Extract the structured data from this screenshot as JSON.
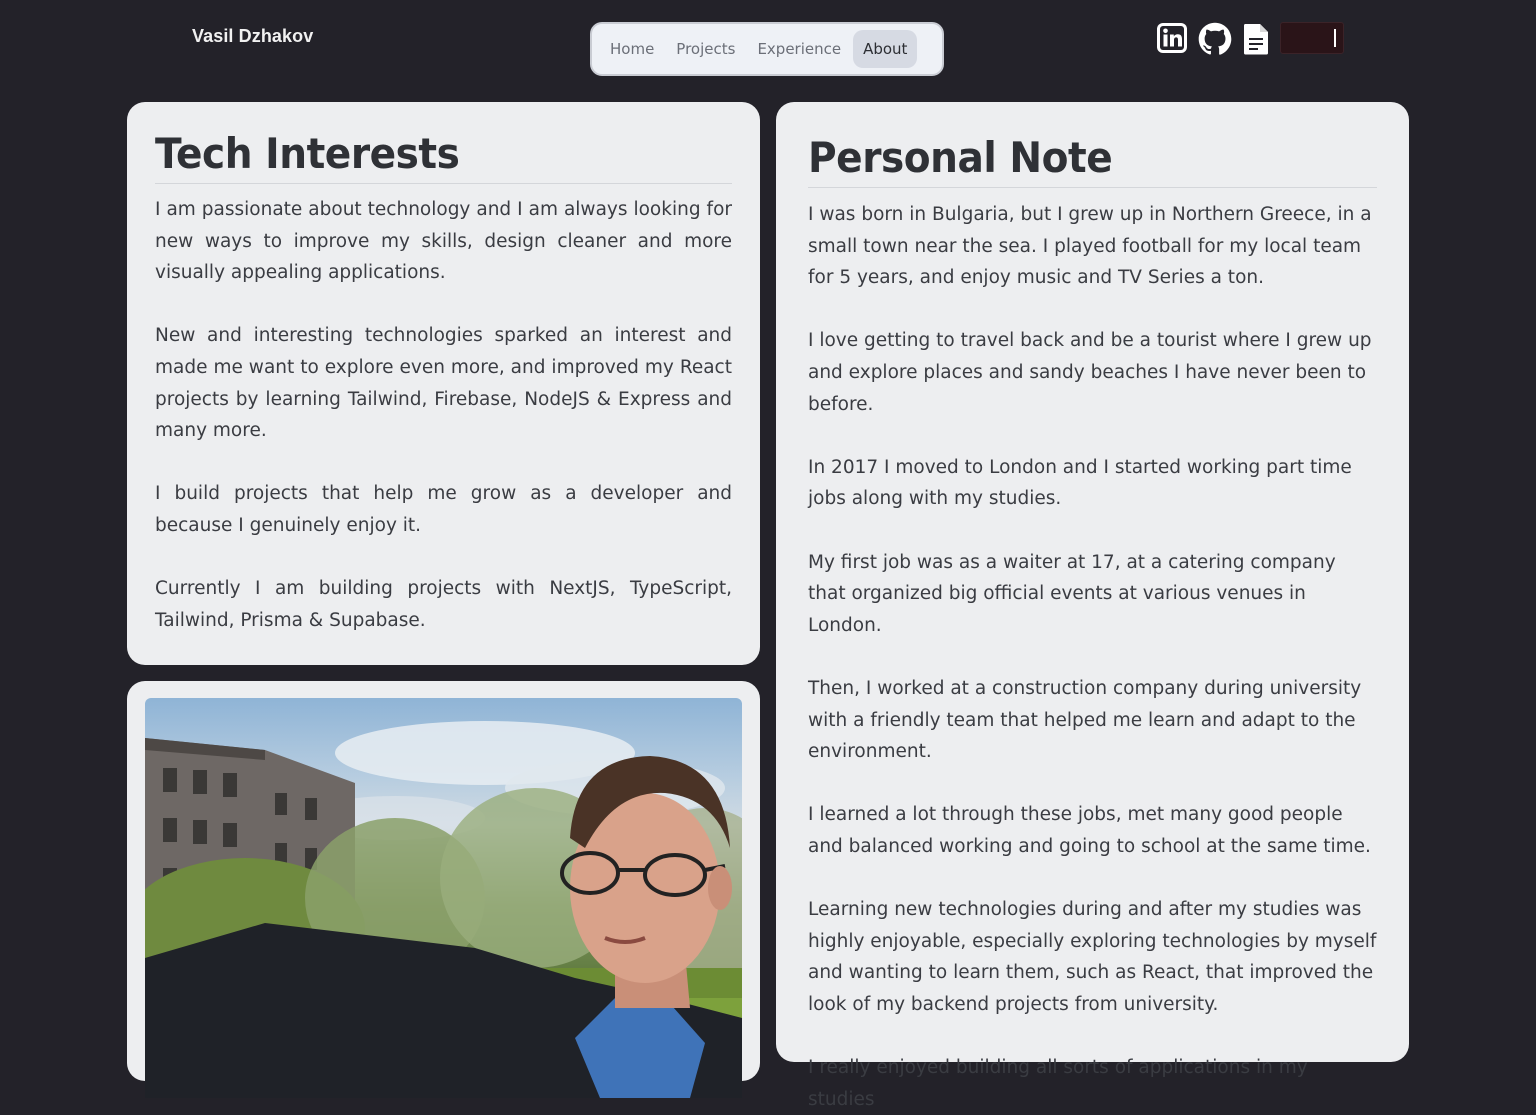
{
  "header": {
    "site_title": "Vasil Dzhakov",
    "nav": [
      {
        "label": "Home",
        "active": false
      },
      {
        "label": "Projects",
        "active": false
      },
      {
        "label": "Experience",
        "active": false
      },
      {
        "label": "About",
        "active": true
      }
    ],
    "social_icons": [
      "linkedin-icon",
      "github-icon",
      "resume-document-icon"
    ],
    "theme_toggle": "dark-mode-toggle"
  },
  "tech_interests": {
    "title": "Tech Interests",
    "paragraphs": [
      "I am passionate about technology and I am always looking for new ways to improve my skills, design cleaner and more visually appealing applications.",
      "New and interesting technologies sparked an interest and made me want to explore even more, and improved my React projects by learning Tailwind, Firebase, NodeJS & Express and many more.",
      "I build projects that help me grow as a developer and because I genuinely enjoy it.",
      "Currently I am building projects with NextJS, TypeScript, Tailwind, Prisma & Supabase."
    ]
  },
  "personal_note": {
    "title": "Personal Note",
    "paragraphs": [
      "I was born in Bulgaria, but I grew up in Northern Greece, in a small town near the sea. I played football for my local team for 5 years, and enjoy music and TV Series a ton.",
      "I love getting to travel back and be a tourist where I grew up and explore places and sandy beaches I have never been to before.",
      "In 2017 I moved to London and I started working part time jobs along with my studies.",
      "My first job was as a waiter at 17, at a catering company that organized big official events at various venues in London.",
      "Then, I worked at a construction company during university with a friendly team that helped me learn and adapt to the environment.",
      "I learned a lot through these jobs, met many good people and balanced working and going to school at the same time.",
      "Learning new technologies during and after my studies was highly enjoyable, especially exploring technologies by myself and wanting to learn them, such as React, that improved the look of my backend projects from university.",
      "I really enjoyed building all sorts of applications in my studies"
    ]
  },
  "photo": {
    "subject": "portrait-photo"
  }
}
